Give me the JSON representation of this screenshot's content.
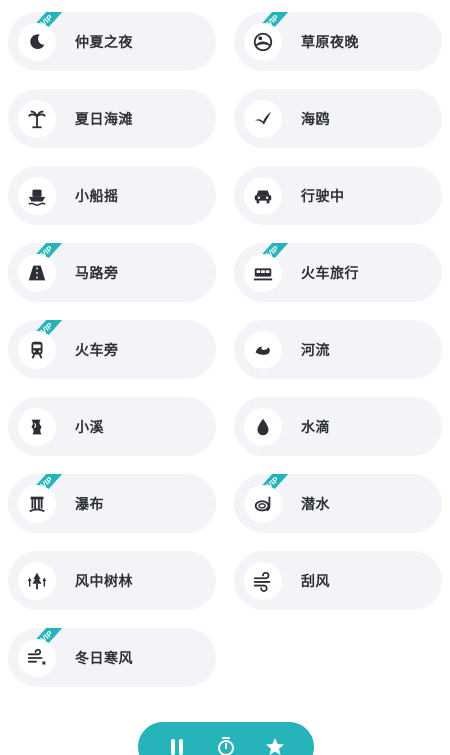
{
  "sounds": [
    {
      "label": "仲夏之夜",
      "icon": "moon-icon",
      "vip": true
    },
    {
      "label": "草原夜晚",
      "icon": "grassland-night-icon",
      "vip": true
    },
    {
      "label": "夏日海滩",
      "icon": "palm-tree-icon",
      "vip": false
    },
    {
      "label": "海鸥",
      "icon": "seagull-icon",
      "vip": false
    },
    {
      "label": "小船摇",
      "icon": "boat-icon",
      "vip": false
    },
    {
      "label": "行驶中",
      "icon": "car-icon",
      "vip": false
    },
    {
      "label": "马路旁",
      "icon": "road-icon",
      "vip": true
    },
    {
      "label": "火车旅行",
      "icon": "train-car-icon",
      "vip": true
    },
    {
      "label": "火车旁",
      "icon": "train-icon",
      "vip": true
    },
    {
      "label": "河流",
      "icon": "river-icon",
      "vip": false
    },
    {
      "label": "小溪",
      "icon": "stream-icon",
      "vip": false
    },
    {
      "label": "水滴",
      "icon": "water-drop-icon",
      "vip": false
    },
    {
      "label": "瀑布",
      "icon": "waterfall-icon",
      "vip": true
    },
    {
      "label": "潜水",
      "icon": "diving-mask-icon",
      "vip": true
    },
    {
      "label": "风中树林",
      "icon": "trees-icon",
      "vip": false
    },
    {
      "label": "刮风",
      "icon": "wind-icon",
      "vip": false
    },
    {
      "label": "冬日寒风",
      "icon": "winter-wind-icon",
      "vip": true
    }
  ],
  "vip_badge": {
    "text": "VIP",
    "color": "#26b3b9"
  },
  "bottom_bar": {
    "color": "#26b3b9",
    "icons": [
      "pause-icon",
      "timer-icon",
      "star-icon"
    ]
  }
}
